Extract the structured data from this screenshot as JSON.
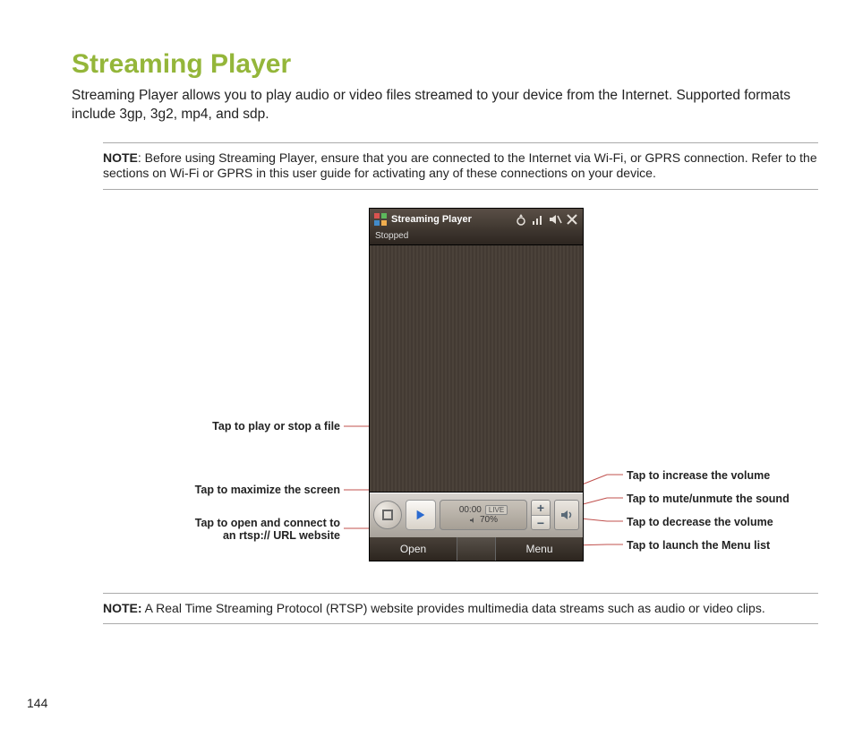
{
  "page_number": "144",
  "title": "Streaming Player",
  "intro": "Streaming Player allows you to play audio or video files streamed to your device from the Internet. Supported formats include 3gp, 3g2, mp4, and sdp.",
  "note1": {
    "label": "NOTE",
    "text": ":    Before using Streaming Player, ensure that you are connected to the Internet via Wi-Fi, or GPRS connection. Refer to the sections on Wi-Fi or GPRS in this user guide for activating any of these connections on your device."
  },
  "note2": {
    "label": "NOTE:",
    "text": "    A Real Time Streaming Protocol (RTSP) website provides multimedia data streams such as audio or video clips."
  },
  "phone": {
    "title": "Streaming Player",
    "status": "Stopped",
    "time": "00:00",
    "vol_pct": "70%",
    "live": "LIVE",
    "softkey_left": "Open",
    "softkey_right": "Menu"
  },
  "callouts": {
    "play": "Tap to play or stop a file",
    "maximize": "Tap to maximize the screen",
    "open_line1": "Tap to open and  connect to",
    "open_line2": "an rtsp:// URL website",
    "vol_up": "Tap to increase the volume",
    "mute": "Tap to mute/unmute the sound",
    "vol_down": "Tap to decrease the volume",
    "menu": "Tap to launch the Menu list"
  }
}
